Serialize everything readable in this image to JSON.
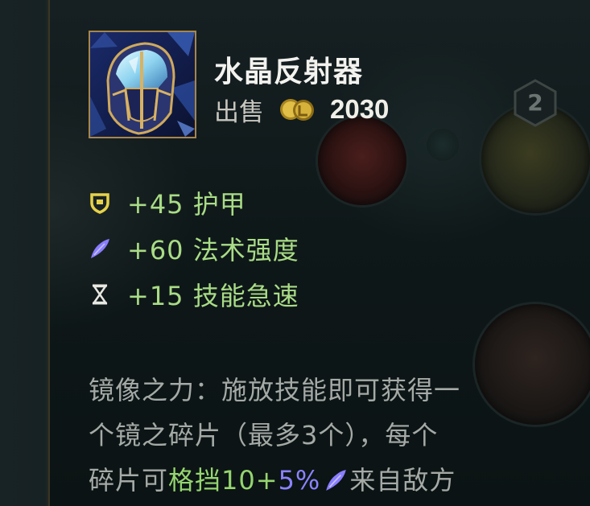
{
  "item": {
    "name": "水晶反射器",
    "sell_label": "出售",
    "sell_price": "2030",
    "icon": "crystal-helmet-icon"
  },
  "badge": {
    "value": "2"
  },
  "stats": [
    {
      "icon": "armor-shield-icon",
      "text": "+45 护甲"
    },
    {
      "icon": "ability-power-icon",
      "text": "+60 法术强度"
    },
    {
      "icon": "ability-haste-icon",
      "text": "+15 技能急速"
    }
  ],
  "description": {
    "line1": "镜像之力：施放技能即可获得一",
    "line2": "个镜之碎片（最多3个），每个",
    "line3_prefix": "碎片可",
    "line3_green": "格挡10+",
    "line3_purple": "5%",
    "line3_suffix": "来自敌方"
  },
  "colors": {
    "stat_green": "#a9dc86",
    "highlight_purple": "#8a83ff",
    "gold": "#d9b23e",
    "icon_border": "#a7864a"
  }
}
